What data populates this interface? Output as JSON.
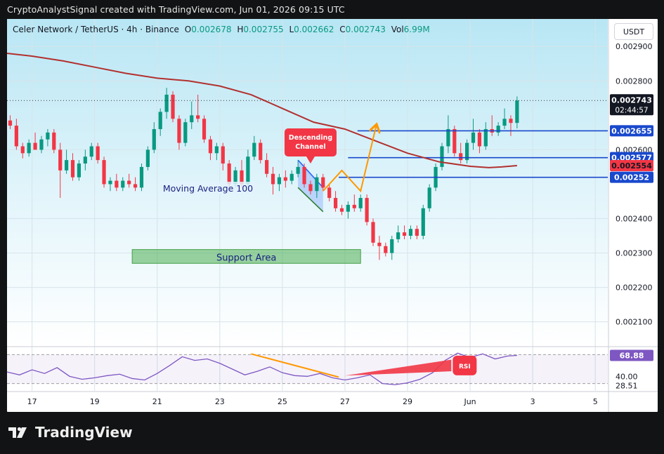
{
  "header": {
    "caption": "CryptoAnalystSignal created with TradingView.com, Jun 01, 2026 09:15 UTC"
  },
  "legend": {
    "symbol": "Celer Network / TetherUS · 4h · Binance",
    "open_label": "O",
    "open": "0.002678",
    "high_label": "H",
    "high": "0.002755",
    "low_label": "L",
    "low": "0.002662",
    "close_label": "C",
    "close": "0.002743",
    "vol_label": "Vol",
    "vol": "6.99M"
  },
  "currency_button": "USDT",
  "footer": {
    "brand": "TradingView"
  },
  "colors": {
    "up": "#089981",
    "down": "#f23645",
    "ma": "#b2302f",
    "level": "#1848cc",
    "rsi": "#7e57c2",
    "arrow": "#ff9800",
    "channel": "#2962ff",
    "support": "#4caf50"
  },
  "chart_data": {
    "type": "candlestick",
    "price_axis": {
      "ticks": [
        0.0029,
        0.0028,
        0.0026,
        0.0024,
        0.0023,
        0.0022,
        0.0021
      ],
      "tick_labels": [
        "0.002900",
        "0.002800",
        "0.002600",
        "0.002400",
        "0.002300",
        "0.002200",
        "0.002100"
      ],
      "range": [
        0.00203,
        0.00298
      ]
    },
    "x_axis": {
      "ticks": [
        17,
        19,
        21,
        23,
        25,
        27,
        29,
        31,
        33,
        35
      ],
      "tick_labels": [
        "17",
        "19",
        "21",
        "23",
        "25",
        "27",
        "29",
        "Jun",
        "3",
        "5"
      ],
      "range": [
        16.2,
        35.4
      ]
    },
    "candles": [
      {
        "t": 16.3,
        "o": 0.002685,
        "h": 0.0027,
        "l": 0.00266,
        "c": 0.00267
      },
      {
        "t": 16.5,
        "o": 0.00267,
        "h": 0.00269,
        "l": 0.0026,
        "c": 0.00261
      },
      {
        "t": 16.7,
        "o": 0.00261,
        "h": 0.00262,
        "l": 0.002575,
        "c": 0.00259
      },
      {
        "t": 16.9,
        "o": 0.00259,
        "h": 0.00263,
        "l": 0.00258,
        "c": 0.00262
      },
      {
        "t": 17.1,
        "o": 0.00262,
        "h": 0.00265,
        "l": 0.0026,
        "c": 0.0026
      },
      {
        "t": 17.3,
        "o": 0.0026,
        "h": 0.00264,
        "l": 0.00259,
        "c": 0.00263
      },
      {
        "t": 17.5,
        "o": 0.00263,
        "h": 0.00266,
        "l": 0.00261,
        "c": 0.00265
      },
      {
        "t": 17.7,
        "o": 0.00265,
        "h": 0.00266,
        "l": 0.00259,
        "c": 0.0026
      },
      {
        "t": 17.9,
        "o": 0.0026,
        "h": 0.00262,
        "l": 0.00246,
        "c": 0.00254
      },
      {
        "t": 18.1,
        "o": 0.00254,
        "h": 0.0026,
        "l": 0.00253,
        "c": 0.00257
      },
      {
        "t": 18.3,
        "o": 0.00257,
        "h": 0.00259,
        "l": 0.00251,
        "c": 0.00252
      },
      {
        "t": 18.5,
        "o": 0.00252,
        "h": 0.00257,
        "l": 0.00251,
        "c": 0.00256
      },
      {
        "t": 18.7,
        "o": 0.00256,
        "h": 0.0026,
        "l": 0.00254,
        "c": 0.00258
      },
      {
        "t": 18.9,
        "o": 0.00258,
        "h": 0.00262,
        "l": 0.00257,
        "c": 0.00261
      },
      {
        "t": 19.1,
        "o": 0.00261,
        "h": 0.00262,
        "l": 0.00256,
        "c": 0.00257
      },
      {
        "t": 19.3,
        "o": 0.00257,
        "h": 0.00258,
        "l": 0.00249,
        "c": 0.0025
      },
      {
        "t": 19.5,
        "o": 0.0025,
        "h": 0.00252,
        "l": 0.00248,
        "c": 0.00251
      },
      {
        "t": 19.7,
        "o": 0.00251,
        "h": 0.00253,
        "l": 0.00248,
        "c": 0.00249
      },
      {
        "t": 19.9,
        "o": 0.00249,
        "h": 0.00252,
        "l": 0.00248,
        "c": 0.00251
      },
      {
        "t": 20.1,
        "o": 0.00251,
        "h": 0.00253,
        "l": 0.00249,
        "c": 0.0025
      },
      {
        "t": 20.3,
        "o": 0.0025,
        "h": 0.00252,
        "l": 0.00248,
        "c": 0.00249
      },
      {
        "t": 20.5,
        "o": 0.00249,
        "h": 0.00256,
        "l": 0.00248,
        "c": 0.00255
      },
      {
        "t": 20.7,
        "o": 0.00255,
        "h": 0.00261,
        "l": 0.00254,
        "c": 0.0026
      },
      {
        "t": 20.9,
        "o": 0.0026,
        "h": 0.00268,
        "l": 0.00259,
        "c": 0.00266
      },
      {
        "t": 21.1,
        "o": 0.00266,
        "h": 0.00272,
        "l": 0.00264,
        "c": 0.00271
      },
      {
        "t": 21.3,
        "o": 0.00271,
        "h": 0.00278,
        "l": 0.00269,
        "c": 0.00276
      },
      {
        "t": 21.5,
        "o": 0.00276,
        "h": 0.00277,
        "l": 0.00268,
        "c": 0.00269
      },
      {
        "t": 21.7,
        "o": 0.00269,
        "h": 0.0027,
        "l": 0.0026,
        "c": 0.00262
      },
      {
        "t": 21.9,
        "o": 0.00262,
        "h": 0.00269,
        "l": 0.00261,
        "c": 0.00268
      },
      {
        "t": 22.1,
        "o": 0.00268,
        "h": 0.00274,
        "l": 0.00266,
        "c": 0.0027
      },
      {
        "t": 22.3,
        "o": 0.0027,
        "h": 0.00276,
        "l": 0.00268,
        "c": 0.00269
      },
      {
        "t": 22.5,
        "o": 0.00269,
        "h": 0.0027,
        "l": 0.00262,
        "c": 0.00263
      },
      {
        "t": 22.7,
        "o": 0.00263,
        "h": 0.00264,
        "l": 0.00257,
        "c": 0.00259
      },
      {
        "t": 22.9,
        "o": 0.00259,
        "h": 0.00262,
        "l": 0.00257,
        "c": 0.00261
      },
      {
        "t": 23.1,
        "o": 0.00261,
        "h": 0.00262,
        "l": 0.00254,
        "c": 0.00256
      },
      {
        "t": 23.3,
        "o": 0.00256,
        "h": 0.00257,
        "l": 0.00248,
        "c": 0.0025
      },
      {
        "t": 23.5,
        "o": 0.0025,
        "h": 0.00255,
        "l": 0.00249,
        "c": 0.00254
      },
      {
        "t": 23.7,
        "o": 0.00254,
        "h": 0.00257,
        "l": 0.00249,
        "c": 0.0025
      },
      {
        "t": 23.9,
        "o": 0.0025,
        "h": 0.0026,
        "l": 0.00249,
        "c": 0.00258
      },
      {
        "t": 24.1,
        "o": 0.00258,
        "h": 0.00264,
        "l": 0.00257,
        "c": 0.00262
      },
      {
        "t": 24.3,
        "o": 0.00262,
        "h": 0.00263,
        "l": 0.00256,
        "c": 0.00257
      },
      {
        "t": 24.5,
        "o": 0.00257,
        "h": 0.00259,
        "l": 0.00252,
        "c": 0.00253
      },
      {
        "t": 24.7,
        "o": 0.00253,
        "h": 0.00255,
        "l": 0.00247,
        "c": 0.0025
      },
      {
        "t": 24.9,
        "o": 0.0025,
        "h": 0.00253,
        "l": 0.00248,
        "c": 0.00252
      },
      {
        "t": 25.1,
        "o": 0.00252,
        "h": 0.00254,
        "l": 0.00249,
        "c": 0.00251
      },
      {
        "t": 25.3,
        "o": 0.00251,
        "h": 0.00254,
        "l": 0.0025,
        "c": 0.00253
      },
      {
        "t": 25.5,
        "o": 0.00253,
        "h": 0.00257,
        "l": 0.00252,
        "c": 0.00255
      },
      {
        "t": 25.7,
        "o": 0.00255,
        "h": 0.00256,
        "l": 0.00249,
        "c": 0.0025
      },
      {
        "t": 25.9,
        "o": 0.0025,
        "h": 0.00251,
        "l": 0.00247,
        "c": 0.00248
      },
      {
        "t": 26.1,
        "o": 0.00248,
        "h": 0.00253,
        "l": 0.00246,
        "c": 0.00252
      },
      {
        "t": 26.3,
        "o": 0.00252,
        "h": 0.00253,
        "l": 0.00248,
        "c": 0.00249
      },
      {
        "t": 26.5,
        "o": 0.00249,
        "h": 0.0025,
        "l": 0.00245,
        "c": 0.00246
      },
      {
        "t": 26.7,
        "o": 0.00246,
        "h": 0.00248,
        "l": 0.00242,
        "c": 0.00243
      },
      {
        "t": 26.9,
        "o": 0.00243,
        "h": 0.00244,
        "l": 0.00241,
        "c": 0.00242
      },
      {
        "t": 27.1,
        "o": 0.00242,
        "h": 0.00245,
        "l": 0.0024,
        "c": 0.00244
      },
      {
        "t": 27.3,
        "o": 0.00244,
        "h": 0.00247,
        "l": 0.00242,
        "c": 0.00243
      },
      {
        "t": 27.5,
        "o": 0.00243,
        "h": 0.00247,
        "l": 0.00242,
        "c": 0.00246
      },
      {
        "t": 27.7,
        "o": 0.00246,
        "h": 0.00247,
        "l": 0.00238,
        "c": 0.00239
      },
      {
        "t": 27.9,
        "o": 0.00239,
        "h": 0.0024,
        "l": 0.00232,
        "c": 0.00233
      },
      {
        "t": 28.1,
        "o": 0.00233,
        "h": 0.00235,
        "l": 0.00228,
        "c": 0.00232
      },
      {
        "t": 28.3,
        "o": 0.00232,
        "h": 0.00233,
        "l": 0.00229,
        "c": 0.0023
      },
      {
        "t": 28.5,
        "o": 0.0023,
        "h": 0.00235,
        "l": 0.00228,
        "c": 0.00234
      },
      {
        "t": 28.7,
        "o": 0.00234,
        "h": 0.00238,
        "l": 0.00233,
        "c": 0.00236
      },
      {
        "t": 28.9,
        "o": 0.00236,
        "h": 0.00238,
        "l": 0.00234,
        "c": 0.00235
      },
      {
        "t": 29.1,
        "o": 0.00235,
        "h": 0.00238,
        "l": 0.00234,
        "c": 0.00237
      },
      {
        "t": 29.3,
        "o": 0.00237,
        "h": 0.00238,
        "l": 0.00234,
        "c": 0.00235
      },
      {
        "t": 29.5,
        "o": 0.00235,
        "h": 0.00244,
        "l": 0.00234,
        "c": 0.00243
      },
      {
        "t": 29.7,
        "o": 0.00243,
        "h": 0.0025,
        "l": 0.00242,
        "c": 0.00249
      },
      {
        "t": 29.9,
        "o": 0.00249,
        "h": 0.00256,
        "l": 0.00248,
        "c": 0.00255
      },
      {
        "t": 30.1,
        "o": 0.00255,
        "h": 0.00262,
        "l": 0.00254,
        "c": 0.00261
      },
      {
        "t": 30.3,
        "o": 0.00261,
        "h": 0.0027,
        "l": 0.00259,
        "c": 0.00266
      },
      {
        "t": 30.5,
        "o": 0.00266,
        "h": 0.00267,
        "l": 0.00258,
        "c": 0.00259
      },
      {
        "t": 30.7,
        "o": 0.00259,
        "h": 0.00262,
        "l": 0.00256,
        "c": 0.00257
      },
      {
        "t": 30.9,
        "o": 0.00257,
        "h": 0.00263,
        "l": 0.00256,
        "c": 0.00262
      },
      {
        "t": 31.1,
        "o": 0.00262,
        "h": 0.00269,
        "l": 0.0026,
        "c": 0.00265
      },
      {
        "t": 31.3,
        "o": 0.00265,
        "h": 0.00266,
        "l": 0.00259,
        "c": 0.00261
      },
      {
        "t": 31.5,
        "o": 0.00261,
        "h": 0.00268,
        "l": 0.0026,
        "c": 0.00266
      },
      {
        "t": 31.7,
        "o": 0.00266,
        "h": 0.0027,
        "l": 0.00264,
        "c": 0.00265
      },
      {
        "t": 31.9,
        "o": 0.00265,
        "h": 0.00268,
        "l": 0.00264,
        "c": 0.00267
      },
      {
        "t": 32.1,
        "o": 0.00267,
        "h": 0.00272,
        "l": 0.00266,
        "c": 0.00269
      },
      {
        "t": 32.3,
        "o": 0.00269,
        "h": 0.0027,
        "l": 0.00264,
        "c": 0.002678
      },
      {
        "t": 32.5,
        "o": 0.002678,
        "h": 0.002755,
        "l": 0.002662,
        "c": 0.002743
      }
    ],
    "ma100": {
      "name": "Moving Average 100",
      "x": [
        16.2,
        17.0,
        18.0,
        19.0,
        20.0,
        21.0,
        22.0,
        23.0,
        24.0,
        25.0,
        26.0,
        27.0,
        28.0,
        29.0,
        30.0,
        31.0,
        31.6,
        32.0,
        32.5
      ],
      "y": [
        0.00288,
        0.002872,
        0.002858,
        0.00284,
        0.002822,
        0.002808,
        0.0028,
        0.002785,
        0.00276,
        0.00272,
        0.00268,
        0.00266,
        0.002625,
        0.00259,
        0.002565,
        0.002552,
        0.002548,
        0.00255,
        0.002554
      ]
    },
    "levels": [
      {
        "value": 0.002655,
        "label": "0.002655",
        "x_start": 27.4
      },
      {
        "value": 0.002577,
        "label": "0.002577",
        "x_start": 27.1
      },
      {
        "value": 0.00252,
        "label": "0.00252",
        "x_start": 26.8
      }
    ],
    "current_price": {
      "value": 0.002743,
      "label": "0.002743",
      "countdown": "02:44:57"
    },
    "ma_price": {
      "value": 0.002554,
      "label": "0.002554"
    },
    "support_area": {
      "label": "Support Area",
      "x_from": 20.2,
      "x_to": 27.5,
      "y_from": 0.00227,
      "y_to": 0.00231
    },
    "channel": {
      "label": "Descending Channel",
      "upper": [
        [
          25.5,
          0.00257
        ],
        [
          26.3,
          0.00249
        ]
      ],
      "lower": [
        [
          25.5,
          0.00249
        ],
        [
          26.3,
          0.00242
        ]
      ]
    },
    "arrow_path": {
      "x": [
        26.3,
        26.9,
        27.5,
        28.0
      ],
      "y": [
        0.00248,
        0.00254,
        0.00248,
        0.00267
      ]
    },
    "rsi": {
      "name": "RSI",
      "value_label": "68.88",
      "min_label": "28.51",
      "level_labels": [
        "40.00"
      ],
      "range": [
        20,
        80
      ],
      "bands": [
        70,
        30
      ],
      "x": [
        16.2,
        16.6,
        17.0,
        17.4,
        17.8,
        18.2,
        18.6,
        19.0,
        19.4,
        19.8,
        20.2,
        20.6,
        21.0,
        21.4,
        21.8,
        22.2,
        22.6,
        23.0,
        23.4,
        23.8,
        24.2,
        24.6,
        25.0,
        25.4,
        25.8,
        26.2,
        26.6,
        27.0,
        27.4,
        27.8,
        28.2,
        28.6,
        29.0,
        29.4,
        29.8,
        30.2,
        30.6,
        31.0,
        31.4,
        31.8,
        32.2,
        32.5
      ],
      "y": [
        46,
        42,
        49,
        44,
        52,
        40,
        36,
        38,
        41,
        43,
        37,
        35,
        44,
        55,
        67,
        62,
        64,
        58,
        50,
        42,
        47,
        53,
        45,
        41,
        40,
        44,
        38,
        35,
        38,
        42,
        30,
        28.5,
        31,
        36,
        45,
        62,
        72,
        66,
        71,
        64,
        68,
        68.88
      ]
    },
    "rsi_trend_down": {
      "x": [
        24.0,
        26.8
      ],
      "y": [
        71,
        39
      ]
    },
    "rsi_trend_up": {
      "x": [
        27.0,
        30.4
      ],
      "y": [
        41,
        55
      ]
    },
    "rsi_badge": "RSI"
  }
}
